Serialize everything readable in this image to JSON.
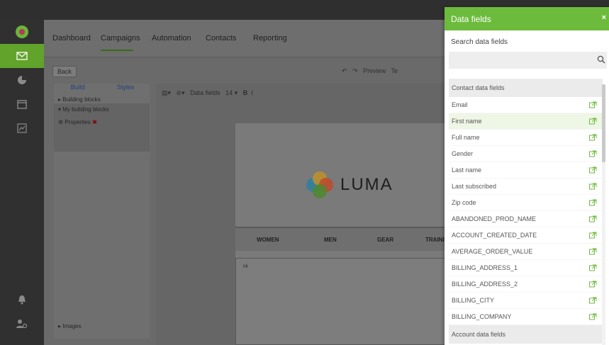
{
  "nav": {
    "items": [
      "Dashboard",
      "Campaigns",
      "Automation",
      "Contacts",
      "Reporting"
    ]
  },
  "subbar": {
    "back_label": "Back",
    "tools": [
      "Preview",
      "Te"
    ]
  },
  "left_panel": {
    "tabs": [
      "Build",
      "Styles"
    ],
    "items": [
      "Building blocks",
      "My building blocks",
      "Properties",
      "Images"
    ]
  },
  "editor": {
    "toolbar": "Data fields",
    "brand": "LUMA",
    "menu": [
      "WOMEN",
      "MEN",
      "GEAR",
      "TRAINI"
    ],
    "body_text": "Hi"
  },
  "data_fields": {
    "title": "Data fields",
    "close": "×",
    "search_label": "Search data fields",
    "search_value": "",
    "groups": [
      {
        "label": "Contact data fields",
        "fields": [
          "Email",
          "First name",
          "Full name",
          "Gender",
          "Last name",
          "Last subscribed",
          "Zip code",
          "ABANDONED_PROD_NAME",
          "ACCOUNT_CREATED_DATE",
          "AVERAGE_ORDER_VALUE",
          "BILLING_ADDRESS_1",
          "BILLING_ADDRESS_2",
          "BILLING_CITY",
          "BILLING_COMPANY"
        ]
      },
      {
        "label": "Account data fields",
        "fields": []
      }
    ],
    "highlighted_field": "First name",
    "accent_color": "#6dbb3c"
  }
}
